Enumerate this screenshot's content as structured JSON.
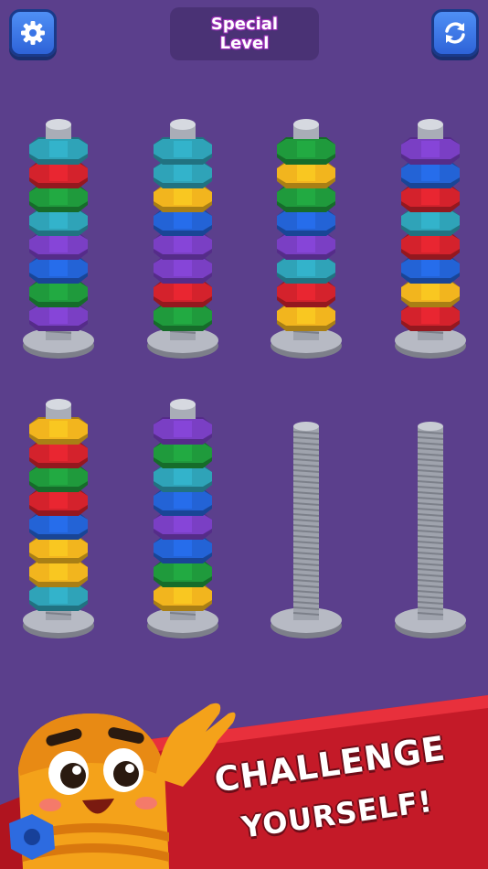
{
  "header": {
    "level_title": "Special\nLevel",
    "settings_icon": "gear-icon",
    "restart_icon": "refresh-icon"
  },
  "colors": {
    "background": "#5b3f8c",
    "teal": "#2fa3b8",
    "red": "#d4222c",
    "green": "#1f9a3c",
    "purple": "#7a3fc4",
    "blue": "#2363d6",
    "yellow": "#f2b51e"
  },
  "stacks": [
    {
      "nuts_top_to_bottom": [
        "teal",
        "red",
        "green",
        "teal",
        "purple",
        "blue",
        "green",
        "purple"
      ]
    },
    {
      "nuts_top_to_bottom": [
        "teal",
        "teal",
        "yellow",
        "blue",
        "purple",
        "purple",
        "red",
        "green"
      ]
    },
    {
      "nuts_top_to_bottom": [
        "green",
        "yellow",
        "green",
        "blue",
        "purple",
        "teal",
        "red",
        "yellow"
      ]
    },
    {
      "nuts_top_to_bottom": [
        "purple",
        "blue",
        "red",
        "teal",
        "red",
        "blue",
        "yellow",
        "red"
      ]
    },
    {
      "nuts_top_to_bottom": [
        "yellow",
        "red",
        "green",
        "red",
        "blue",
        "yellow",
        "yellow",
        "teal"
      ]
    },
    {
      "nuts_top_to_bottom": [
        "purple",
        "green",
        "teal",
        "blue",
        "purple",
        "blue",
        "green",
        "yellow"
      ]
    },
    {
      "nuts_top_to_bottom": []
    },
    {
      "nuts_top_to_bottom": []
    }
  ],
  "banner": {
    "line1": "CHALLENGE",
    "line2": "YOURSELF!",
    "mascot_icon": "bolt-mascot-icon"
  }
}
